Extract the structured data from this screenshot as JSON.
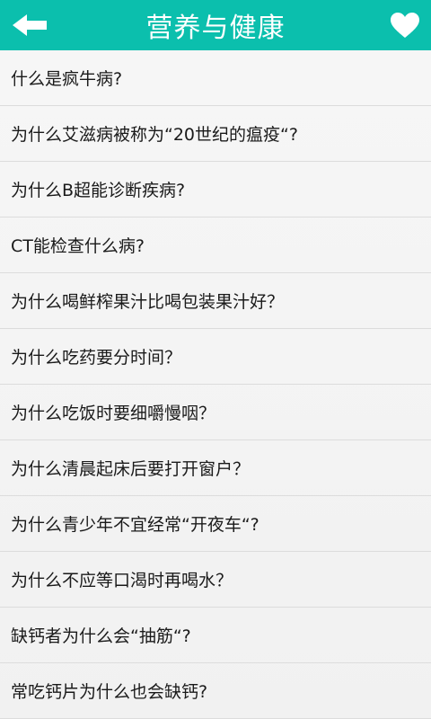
{
  "header": {
    "title": "营养与健康",
    "back_icon": "arrow-left-icon",
    "favorite_icon": "heart-icon",
    "bg_color": "#0bbfad"
  },
  "list": {
    "items": [
      "什么是疯牛病?",
      "为什么艾滋病被称为“20世纪的瘟疫“?",
      "为什么B超能诊断疾病?",
      "CT能检查什么病?",
      "为什么喝鲜榨果汁比喝包装果汁好？",
      "为什么吃药要分时间？",
      "为什么吃饭时要细嚼慢咽？",
      "为什么清晨起床后要打开窗户？",
      "为什么青少年不宜经常“开夜车“?",
      "为什么不应等口渴时再喝水？",
      "缺钙者为什么会“抽筋“?",
      "常吃钙片为什么也会缺钙?"
    ]
  }
}
